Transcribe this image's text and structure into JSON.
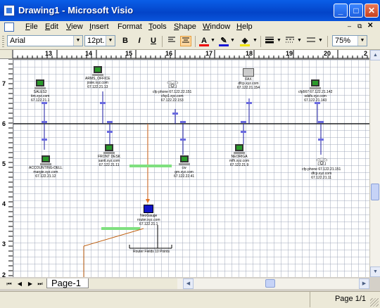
{
  "window": {
    "title": "Drawing1 - Microsoft Visio"
  },
  "menu": {
    "doc_icon": "visio-doc-icon",
    "items": [
      {
        "key": "F",
        "rest": "ile"
      },
      {
        "key": "E",
        "rest": "dit"
      },
      {
        "key": "V",
        "rest": "iew"
      },
      {
        "key": "I",
        "rest": "nsert"
      },
      {
        "key": "",
        "rest": "Format"
      },
      {
        "key": "T",
        "rest": "ools"
      },
      {
        "key": "S",
        "rest": "hape"
      },
      {
        "key": "W",
        "rest": "indow"
      },
      {
        "key": "H",
        "rest": "elp"
      }
    ]
  },
  "toolbar": {
    "font": "Arial",
    "size": "12pt.",
    "bold": "B",
    "italic": "I",
    "underline": "U",
    "zoom": "75%"
  },
  "ruler": {
    "h": [
      "13",
      "14",
      "15",
      "16",
      "17",
      "18",
      "19",
      "20",
      "2"
    ],
    "v": [
      "7",
      "6",
      "5",
      "4",
      "3",
      "2"
    ]
  },
  "diagram": {
    "nodes": [
      {
        "id": "n1",
        "lines": [
          "SALES2",
          "tim.xyz.com",
          "67.122.21.1"
        ]
      },
      {
        "id": "n2",
        "lines": [
          "ARMS_OFFICE",
          "josie.xyz.com",
          "67.122.21.13"
        ]
      },
      {
        "id": "n3",
        "lines": [
          "cfp phone 67.122.22.151",
          "cfcp1.xyz.com",
          "67.122.22.153"
        ]
      },
      {
        "id": "n4",
        "lines": [
          "FAX",
          "dfcp.xyz.com",
          "67.122.21.154"
        ]
      },
      {
        "id": "n5",
        "lines": [
          "cfp567 67.122.21.142",
          "sdsfs.xyz.com",
          "67.122.21.143"
        ]
      },
      {
        "id": "n6",
        "lines": [
          "ACCOUNTING-DELL",
          "margie.xyz.com",
          "67.122.21.12"
        ]
      },
      {
        "id": "n7",
        "lines": [
          "FRONT DESK",
          "santi.xyz.com",
          "67.122.21.11"
        ]
      },
      {
        "id": "n8",
        "lines": [
          "cw",
          "gm.xyz.com",
          "67.122.22.41"
        ]
      },
      {
        "id": "n9",
        "lines": [
          "NEORIGA",
          "mfh.xyz.com",
          "67.122.21.9"
        ]
      },
      {
        "id": "n10",
        "lines": [
          "cfp phone 67.122.21.151",
          "dfcp.xyz.com",
          "67.122.21.11"
        ]
      },
      {
        "id": "n11",
        "lines": [
          "NeoGauge",
          "router.xyz.com",
          "67.122.21.1"
        ]
      }
    ],
    "subnet_label": "Router Fields 10 Points"
  },
  "tabs": {
    "page": "Page-1"
  },
  "status": {
    "page": "Page 1/1"
  }
}
